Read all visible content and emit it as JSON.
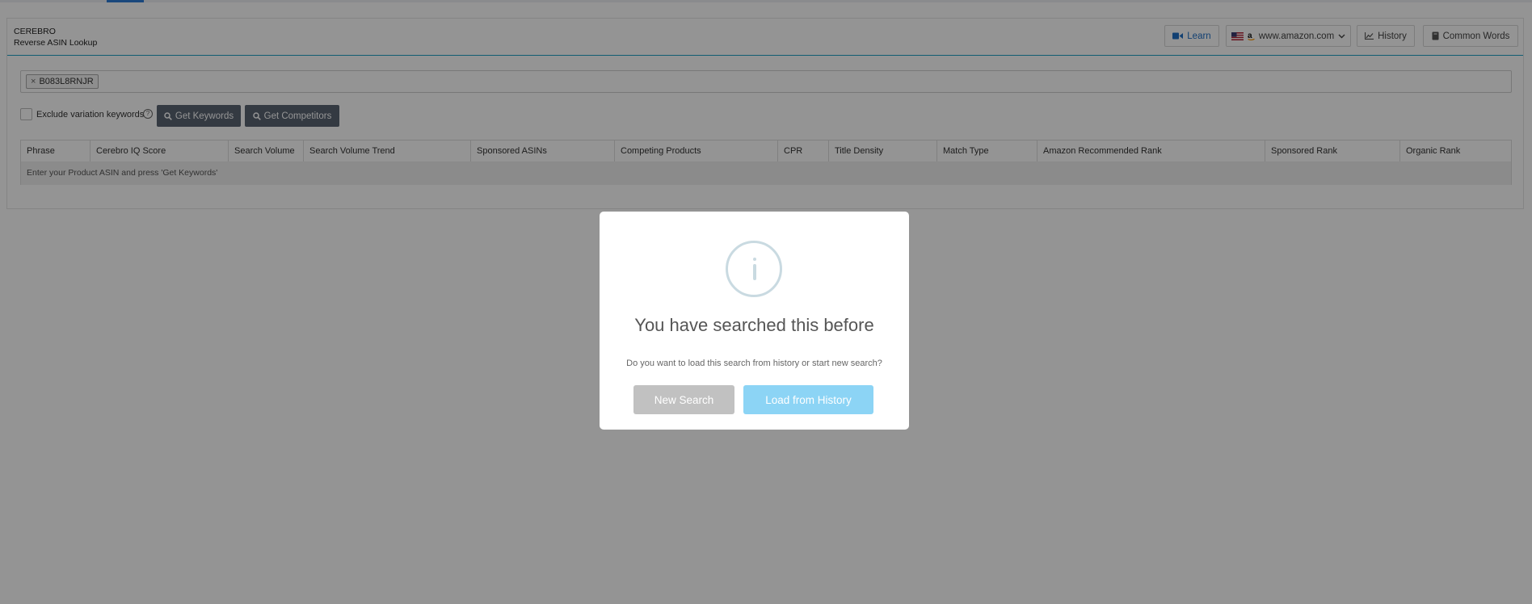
{
  "header": {
    "brand": "CEREBRO",
    "subtitle": "Reverse ASIN Lookup",
    "learn_label": "Learn",
    "marketplace_label": "www.amazon.com",
    "history_label": "History",
    "common_words_label": "Common Words"
  },
  "search": {
    "asin_tag": "B083L8RNJR",
    "remove_symbol": "×"
  },
  "options": {
    "exclude_label": "Exclude variation keywords",
    "exclude_checked": false,
    "help_symbol": "?",
    "get_keywords_label": "Get Keywords",
    "get_competitors_label": "Get Competitors"
  },
  "table": {
    "columns": [
      "Phrase",
      "Cerebro IQ Score",
      "Search Volume",
      "Search Volume Trend",
      "Sponsored ASINs",
      "Competing Products",
      "CPR",
      "Title Density",
      "Match Type",
      "Amazon Recommended Rank",
      "Sponsored Rank",
      "Organic Rank"
    ],
    "empty_message": "Enter your Product ASIN and press 'Get Keywords'"
  },
  "modal": {
    "icon": "info-icon",
    "title": "You have searched this before",
    "text": "Do you want to load this search from history or start new search?",
    "new_search_label": "New Search",
    "load_history_label": "Load from History"
  },
  "colors": {
    "accent": "#1ea1c7",
    "learn_text": "#1f6fc4",
    "dark_button": "#5a6473",
    "load_button": "#8cd4f5",
    "new_button": "#c1c1c1",
    "overlay": "rgba(0,0,0,0.42)"
  }
}
